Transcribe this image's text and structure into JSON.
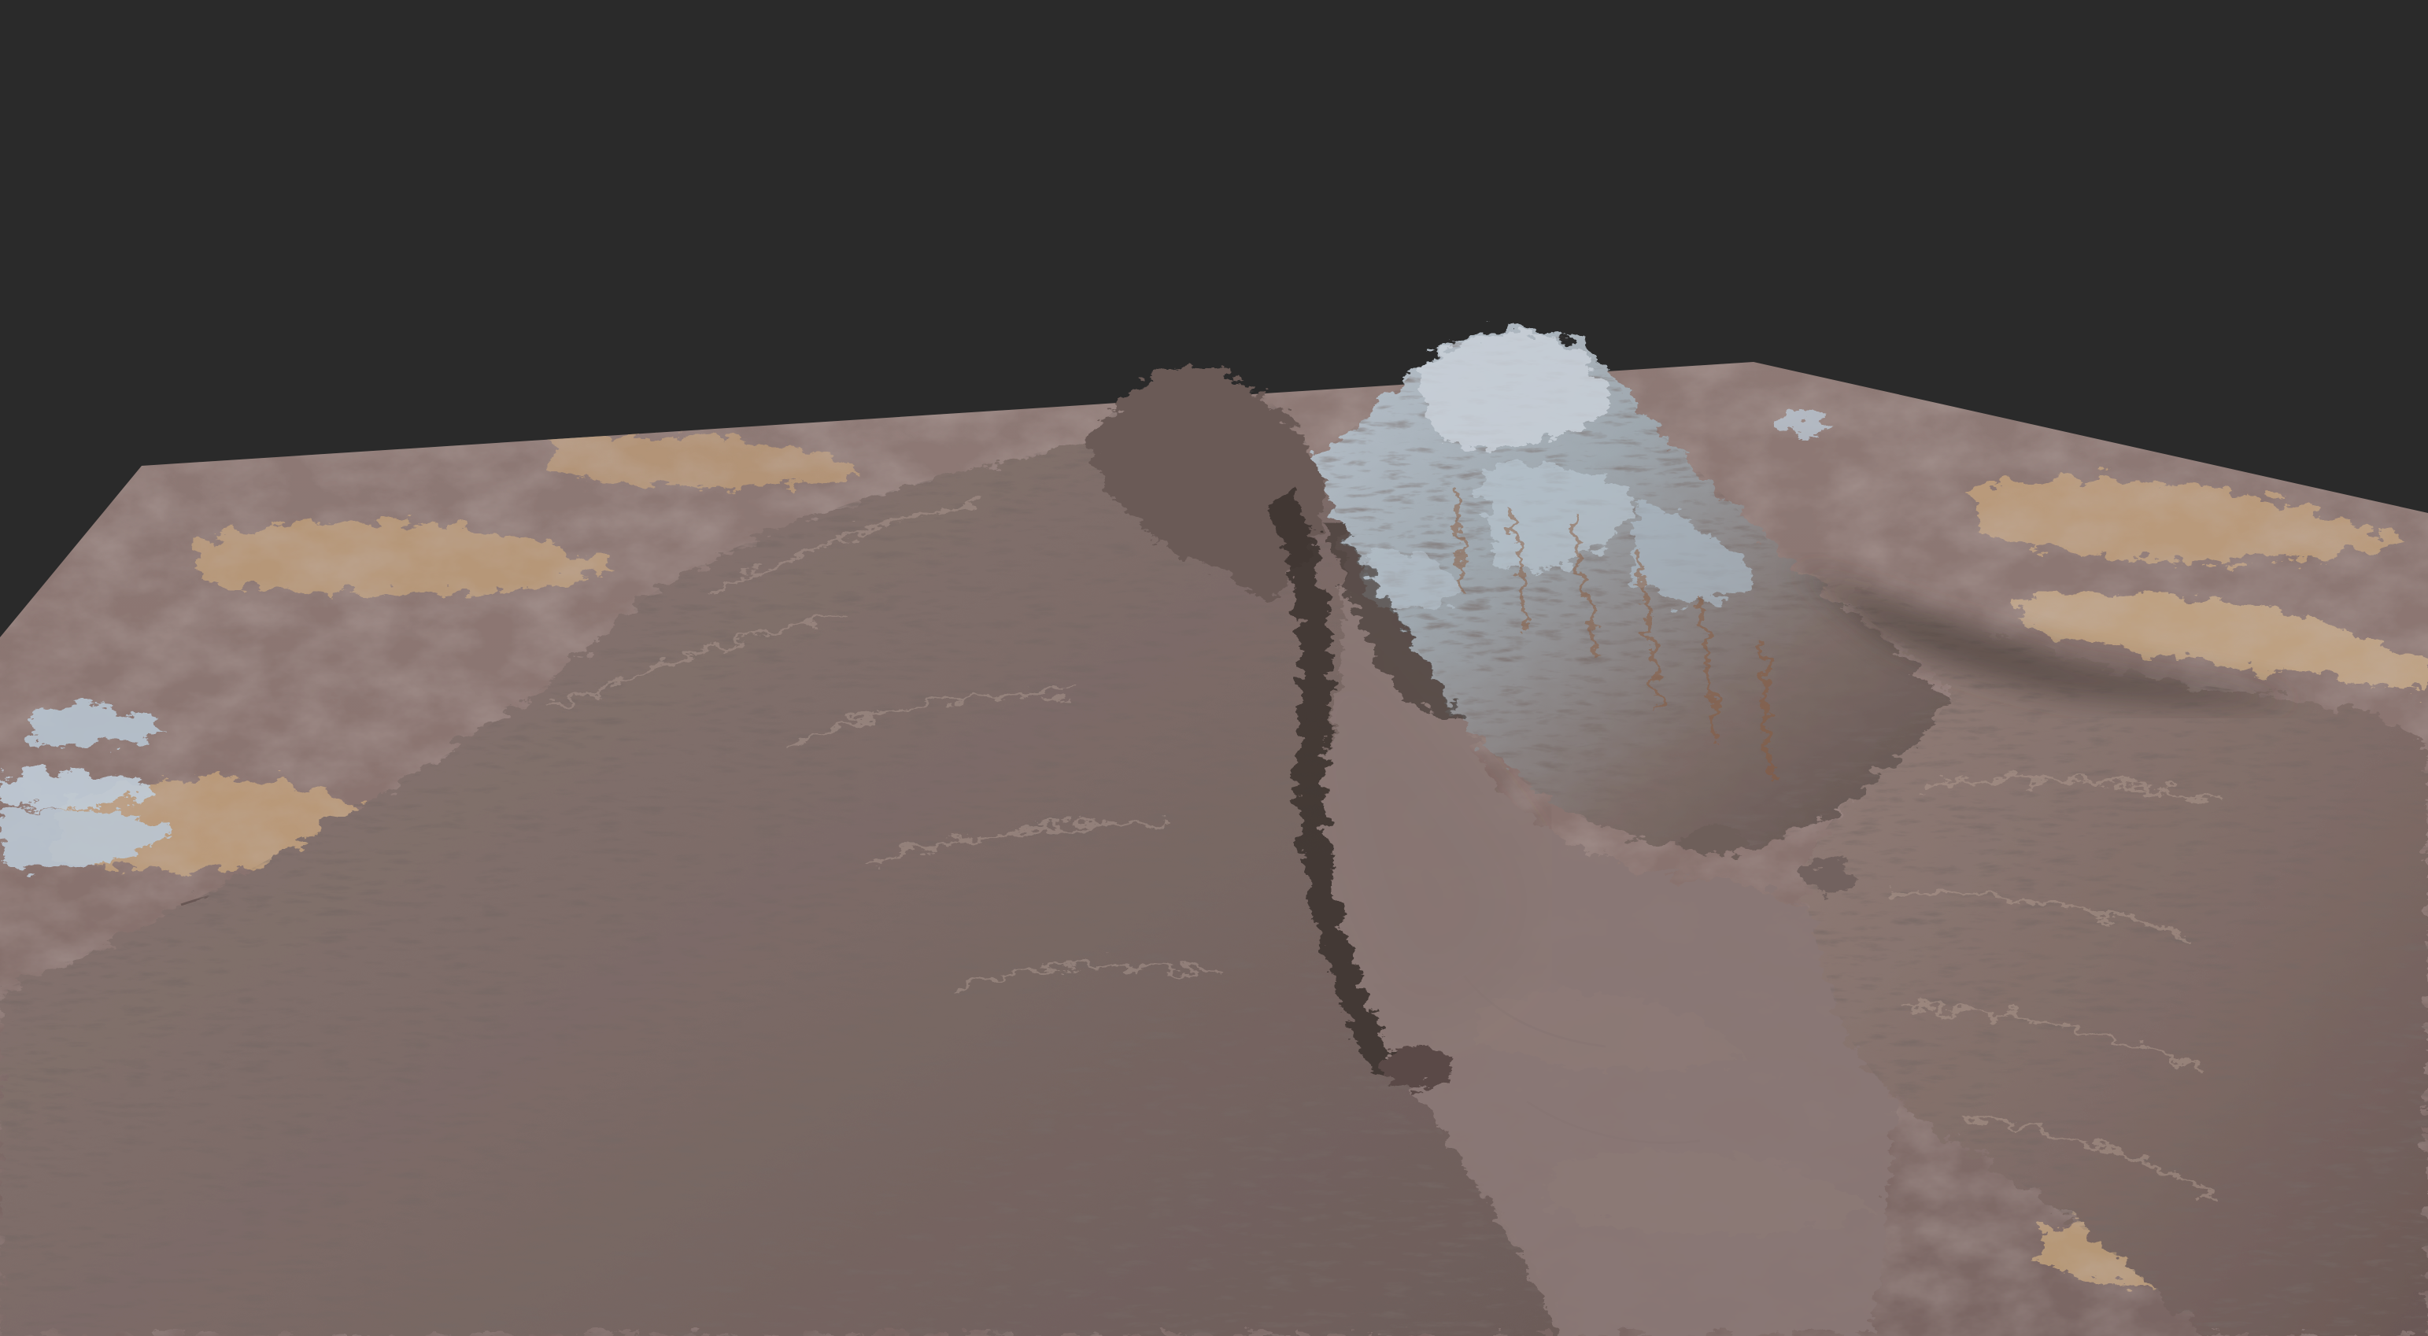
{
  "viewport": {
    "background_color": "#2a2a2a",
    "content": "terrain-render"
  },
  "terrain": {
    "palette": {
      "plain_base": "#8a7672",
      "plain_light": "#a48e86",
      "plain_dark": "#6e5c5a",
      "sand": "#c4a27a",
      "sand_light": "#d8bb92",
      "rock": "#7a6a66",
      "rock_dark": "#4c3e3c",
      "rock_shadow": "#3a302f",
      "snow": "#c9d0d8",
      "snow_blue": "#9fb4c6",
      "water": "#b9c6d2",
      "rust": "#8a5a3c"
    }
  }
}
